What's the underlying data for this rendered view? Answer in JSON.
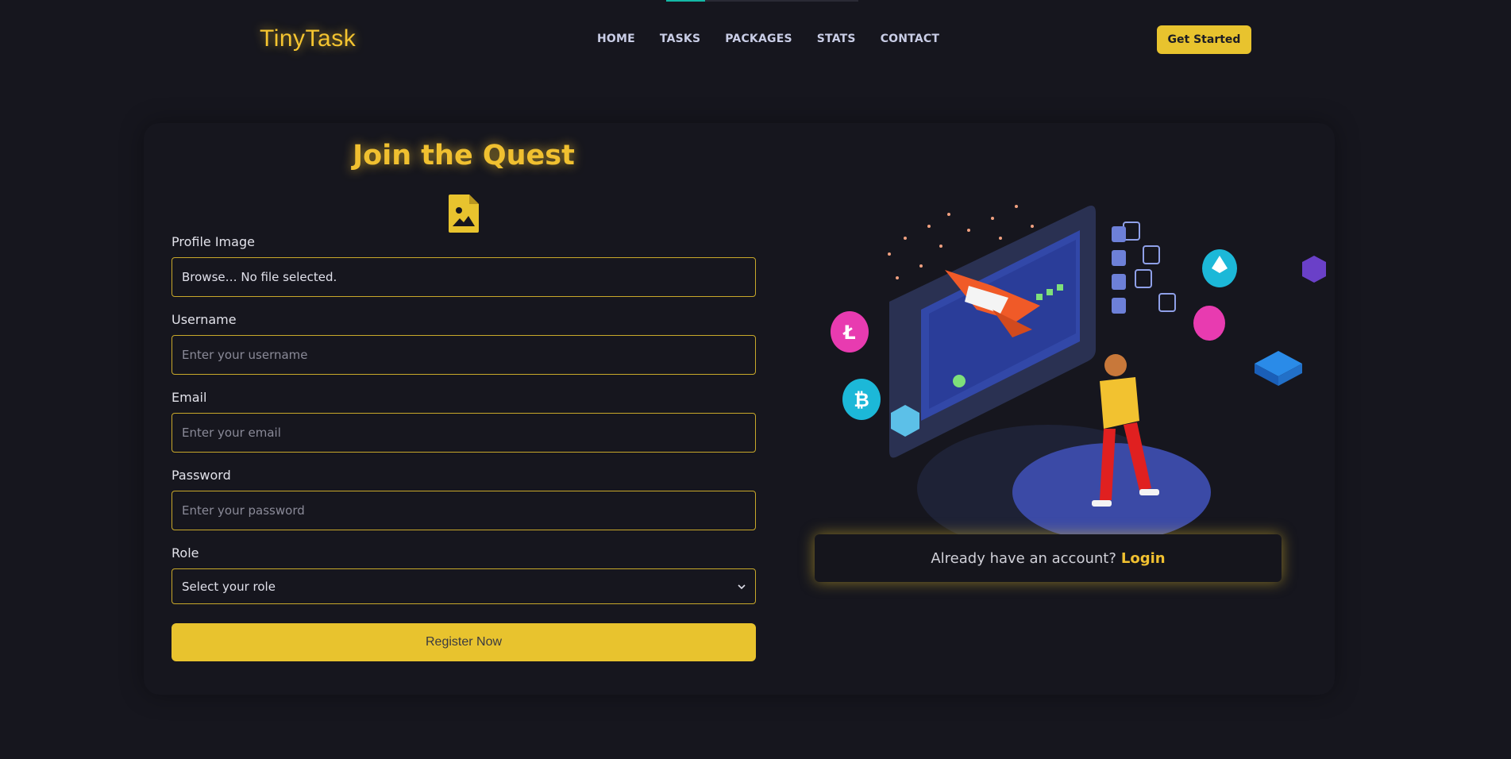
{
  "brand": {
    "logo": "TinyTask"
  },
  "nav": {
    "items": [
      {
        "label": "HOME"
      },
      {
        "label": "TASKS"
      },
      {
        "label": "PACKAGES"
      },
      {
        "label": "STATS"
      },
      {
        "label": "CONTACT"
      }
    ],
    "cta_label": "Get Started"
  },
  "form": {
    "title": "Join the Quest",
    "profile_image": {
      "label": "Profile Image",
      "value": "Browse… No file selected."
    },
    "username": {
      "label": "Username",
      "placeholder": "Enter your username"
    },
    "email": {
      "label": "Email",
      "placeholder": "Enter your email"
    },
    "password": {
      "label": "Password",
      "placeholder": "Enter your password"
    },
    "role": {
      "label": "Role",
      "selected": "Select your role"
    },
    "submit_label": "Register Now"
  },
  "login_prompt": {
    "text": "Already have an account?",
    "link": "Login"
  },
  "colors": {
    "accent": "#e8c32e",
    "background": "#16161e",
    "teal": "#14b8a6"
  }
}
